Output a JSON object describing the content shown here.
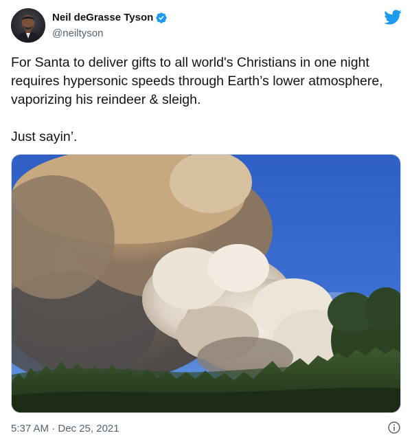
{
  "author": {
    "name": "Neil deGrasse Tyson",
    "handle": "@neiltyson",
    "verified": true
  },
  "tweet": {
    "text": "For Santa to deliver gifts to all world's Christians in one night requires hypersonic speeds through Earth’s lower atmosphere, vaporizing his reindeer & sleigh.\n\nJust sayin’.",
    "media": {
      "type": "photo",
      "icon": "smoke-plume-photo"
    },
    "timestamp": "5:37 AM · Dec 25, 2021"
  },
  "icons": {
    "brand": "twitter-bird-icon",
    "verified": "verified-badge-icon",
    "info": "info-icon"
  },
  "colors": {
    "brand_blue": "#1d9bf0",
    "text_primary": "#0f1419",
    "text_secondary": "#536471",
    "border": "#cfd9de"
  }
}
